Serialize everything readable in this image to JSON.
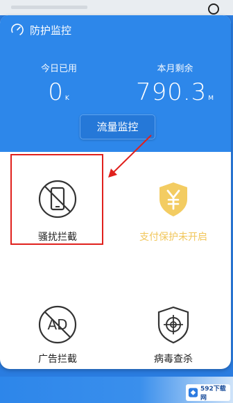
{
  "header": {
    "title": "防护监控"
  },
  "stats": {
    "today": {
      "label": "今日已用",
      "value": "0",
      "unit": "K"
    },
    "month": {
      "label": "本月剩余",
      "value": "790.3",
      "unit": "M"
    }
  },
  "monitor_button": {
    "label": "流量监控"
  },
  "tiles": [
    {
      "label": "骚扰拦截",
      "icon": "no-phone-icon"
    },
    {
      "label": "支付保护未开启",
      "icon": "yuan-shield-icon"
    },
    {
      "label": "广告拦截",
      "icon": "no-ad-icon"
    },
    {
      "label": "病毒查杀",
      "icon": "crosshair-shield-icon"
    }
  ],
  "colors": {
    "header_blue": "#2d87ea",
    "highlight_red": "#e0201c",
    "payment_yellow": "#f1c65a"
  },
  "watermark": {
    "text": "592下载网"
  }
}
